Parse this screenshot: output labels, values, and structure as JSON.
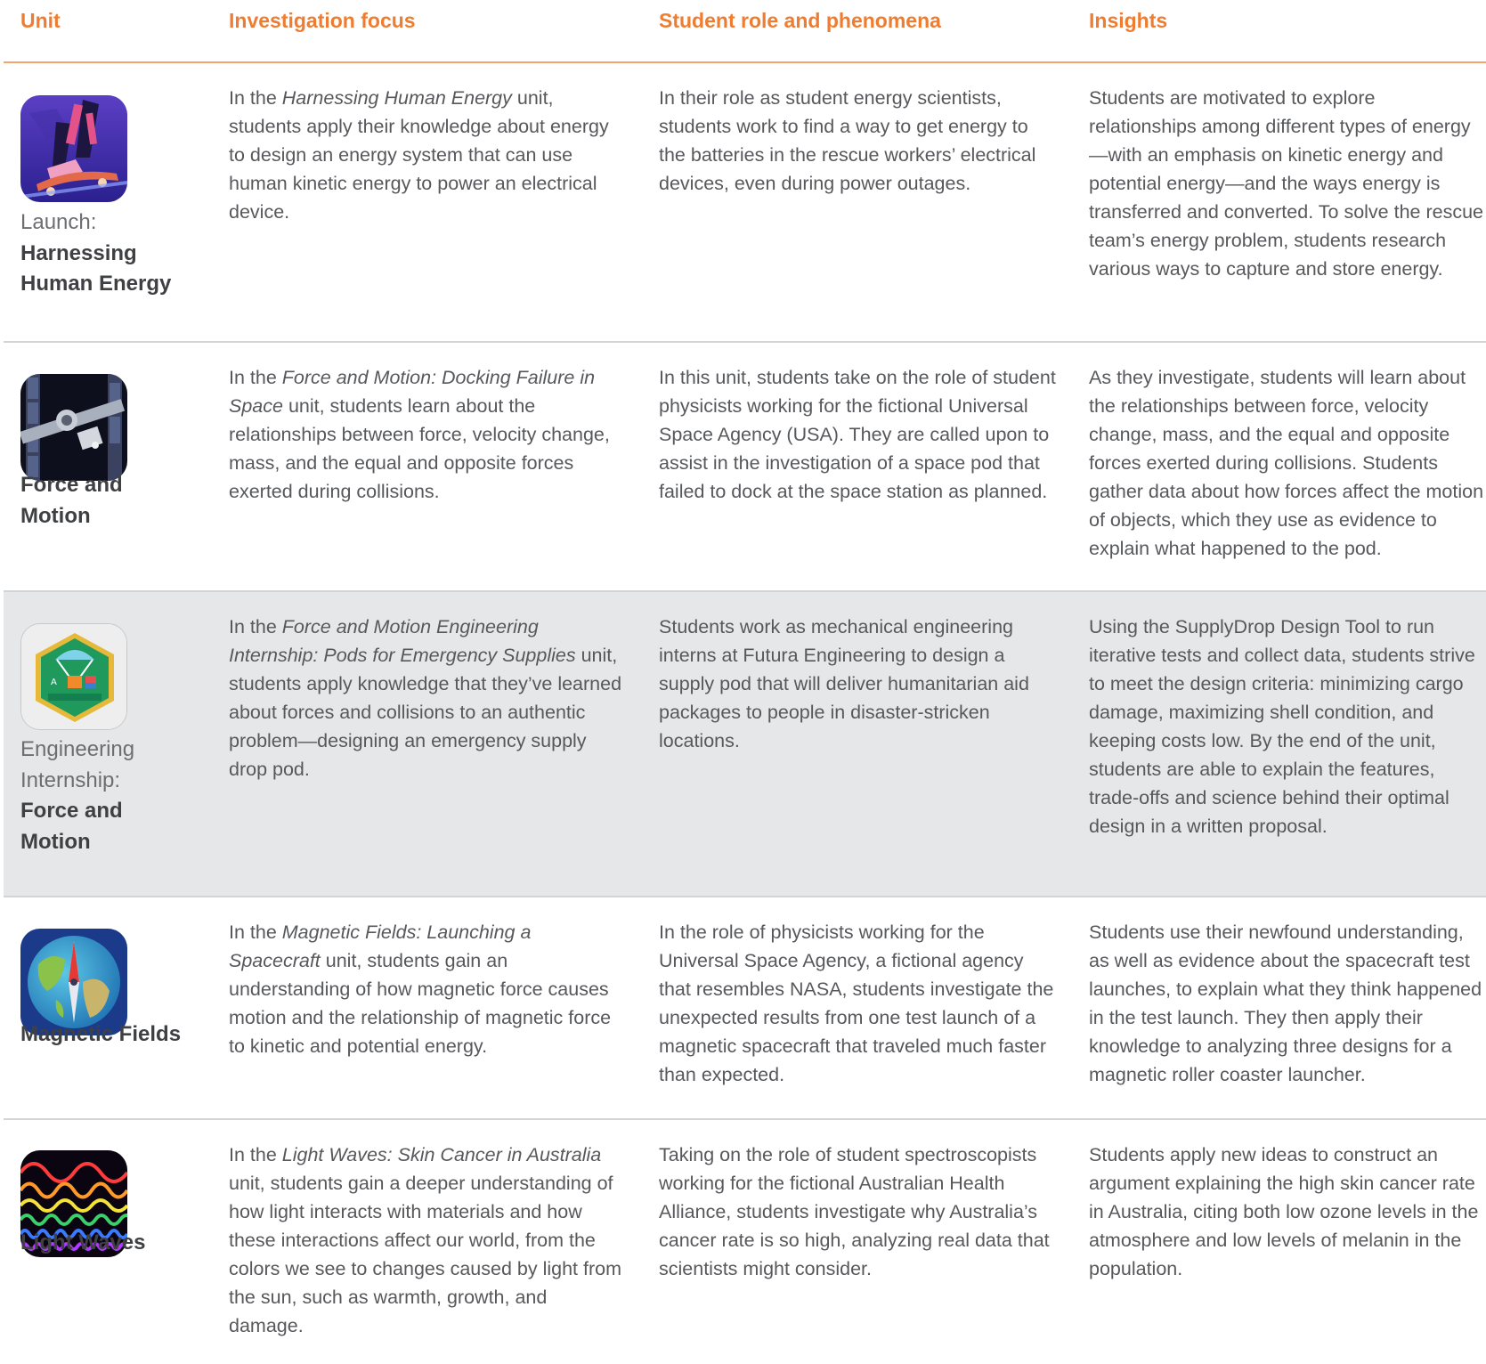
{
  "header": {
    "unit": "Unit",
    "investigation": "Investigation focus",
    "student_role": "Student role and phenomena",
    "insights": "Insights"
  },
  "rows": [
    {
      "icon": "skateboard-icon",
      "unit_prefix": "Launch:",
      "unit_name": "Harnessing Human Energy",
      "investigation_pre": "In the ",
      "investigation_title": "Harnessing Human Energy",
      "investigation_post": " unit, students apply their knowledge about energy to design an energy system that can use human kinetic energy to power an electrical device.",
      "student_role": "In their role as student energy scientists, students work to find a way to get energy to the batteries in the rescue workers’ electrical devices, even during power outages.",
      "insights": "Students are motivated to explore relationships among different types of energy—with an emphasis on kinetic energy and potential energy—and the ways energy is transferred and converted. To solve the rescue team’s energy problem, students research various ways to capture and store energy."
    },
    {
      "icon": "space-station-icon",
      "unit_prefix": "",
      "unit_name": "Force and Motion",
      "investigation_pre": "In the ",
      "investigation_title": "Force and Motion: Docking Failure in Space",
      "investigation_post": " unit, students learn about the relationships between force, velocity change, mass, and the equal and opposite forces exerted during collisions.",
      "student_role": "In this unit, students take on the role of student physicists working for the fictional Universal Space Agency (USA). They are called upon to assist in the investigation of a space pod that failed to dock at the space station as planned.",
      "insights": "As they investigate, students will learn about the relationships between force, velocity change, mass, and the equal and opposite forces exerted during collisions. Students gather data about how forces affect the motion of objects, which they use as evidence to explain what happened to the pod."
    },
    {
      "icon": "supply-drop-badge-icon",
      "unit_prefix": "Engineering Internship:",
      "unit_name": "Force and Motion",
      "investigation_pre": "In the ",
      "investigation_title": "Force and Motion Engineering Internship: Pods for Emergency Supplies",
      "investigation_post": " unit, students apply knowledge that they’ve learned about forces and collisions to an authentic problem—designing an emergency supply drop pod.",
      "student_role": "Students work as mechanical engineering interns at Futura Engineering to design a supply pod that will deliver humanitarian aid packages to people in disaster-stricken locations.",
      "insights": "Using the SupplyDrop Design Tool to run iterative tests and collect data, students strive to meet the design criteria: minimizing cargo damage, maximizing shell condition, and keeping costs low. By the end of the unit, students are able to explain the features, trade-offs and science behind their optimal design in a written proposal."
    },
    {
      "icon": "globe-compass-icon",
      "unit_prefix": "",
      "unit_name": "Magnetic Fields",
      "investigation_pre": "In the ",
      "investigation_title": "Magnetic Fields: Launching a Spacecraft",
      "investigation_post": " unit, students gain an understanding of how magnetic force causes motion and the relationship of magnetic force to kinetic and potential energy.",
      "student_role": "In the role of physicists working for the Universal Space Agency, a fictional agency that resembles NASA, students investigate the unexpected results from one test launch of a magnetic spacecraft that traveled much faster than expected.",
      "insights": "Students use their newfound understanding, as well as evidence about the spacecraft test launches, to explain what they think happened in the test launch. They then apply their knowledge to analyzing three designs for a magnetic roller coaster launcher."
    },
    {
      "icon": "waves-icon",
      "unit_prefix": "",
      "unit_name": "Light Waves",
      "investigation_pre": "In the ",
      "investigation_title": "Light Waves: Skin Cancer in Australia",
      "investigation_post": " unit, students gain a deeper understanding of how light interacts with materials and how these interactions affect our world, from the colors we see to changes caused by light from the sun, such as warmth, growth, and damage.",
      "student_role": "Taking on the role of student spectroscopists working for the fictional Australian Health Alliance, students investigate why Australia’s cancer rate is so high, analyzing real data that scientists might consider.",
      "insights": "Students apply new ideas to construct an argument explaining the high skin cancer rate in Australia, citing both low ozone levels in the atmosphere and low levels of melanin in the population."
    }
  ],
  "colors": {
    "header_accent": "#ee7d31",
    "shaded_row": "#e6e7e8",
    "divider": "#d3d4d6"
  }
}
